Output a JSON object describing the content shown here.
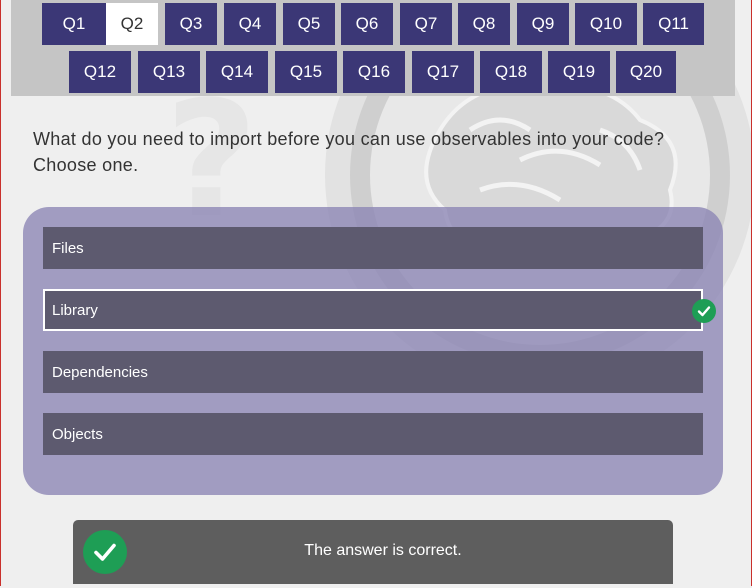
{
  "nav": {
    "questions": [
      {
        "label": "Q1",
        "active": false
      },
      {
        "label": "Q2",
        "active": true
      },
      {
        "label": "Q3",
        "active": false
      },
      {
        "label": "Q4",
        "active": false
      },
      {
        "label": "Q5",
        "active": false
      },
      {
        "label": "Q6",
        "active": false
      },
      {
        "label": "Q7",
        "active": false
      },
      {
        "label": "Q8",
        "active": false
      },
      {
        "label": "Q9",
        "active": false
      },
      {
        "label": "Q10",
        "active": false
      },
      {
        "label": "Q11",
        "active": false
      },
      {
        "label": "Q12",
        "active": false
      },
      {
        "label": "Q13",
        "active": false
      },
      {
        "label": "Q14",
        "active": false
      },
      {
        "label": "Q15",
        "active": false
      },
      {
        "label": "Q16",
        "active": false
      },
      {
        "label": "Q17",
        "active": false
      },
      {
        "label": "Q18",
        "active": false
      },
      {
        "label": "Q19",
        "active": false
      },
      {
        "label": "Q20",
        "active": false
      }
    ]
  },
  "question": {
    "text": "What do you need to import before you can use observables into your code? Choose one."
  },
  "options": [
    {
      "label": "Files",
      "selected": false
    },
    {
      "label": "Library",
      "selected": true,
      "correct": true
    },
    {
      "label": "Dependencies",
      "selected": false
    },
    {
      "label": "Objects",
      "selected": false
    }
  ],
  "feedback": {
    "text": "The answer is correct.",
    "icon": "check-circle-icon"
  },
  "colors": {
    "nav_button": "#3b3776",
    "option_bg": "#5d5a6f",
    "success": "#1e9e55",
    "feedback_bg": "#5e5e5e"
  }
}
